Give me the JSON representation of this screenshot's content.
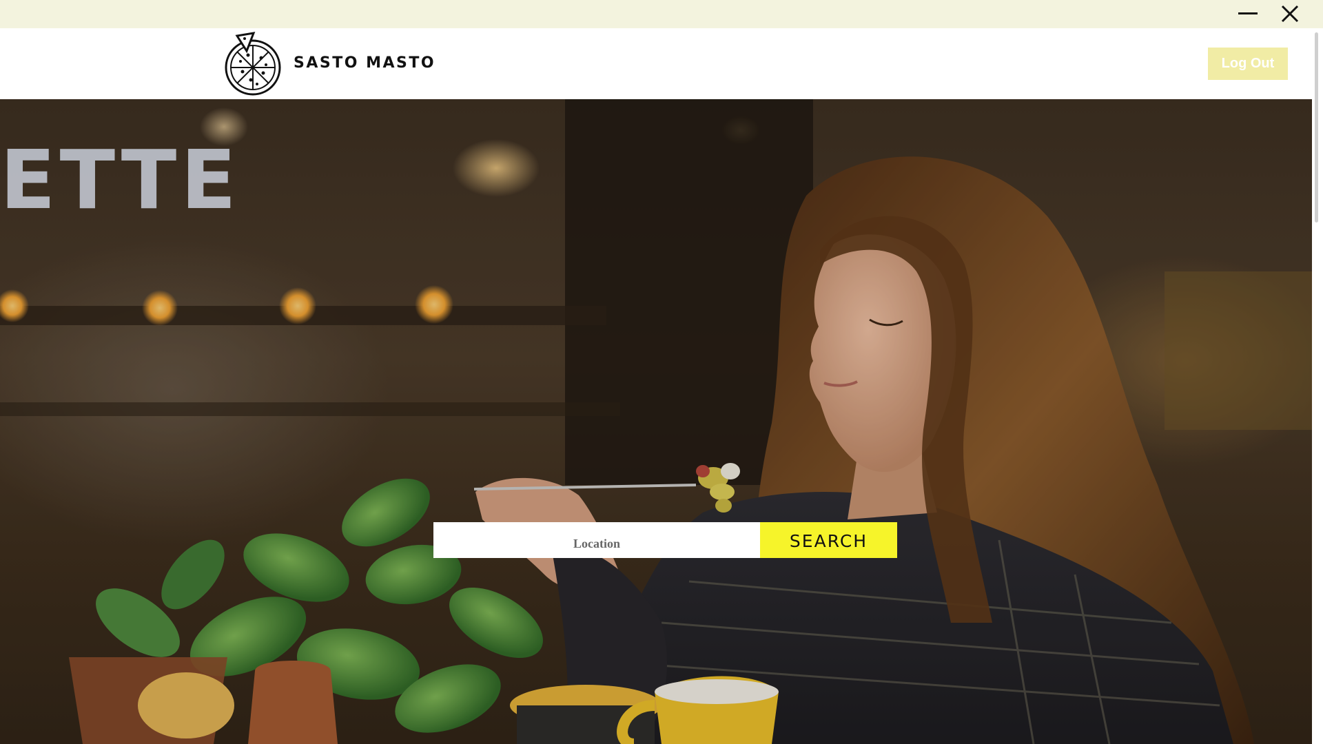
{
  "window": {
    "minimize_icon": "minimize-icon",
    "close_icon": "close-icon",
    "titlebar_color": "#f3f3de"
  },
  "header": {
    "logo_icon": "pizza-icon",
    "brand_name": "SASTO MASTO",
    "logout_label": "Log Out",
    "logout_color": "#f1eca5"
  },
  "hero": {
    "image": "woman-eating-pasta-photo",
    "neon_sign_text": "ETTE",
    "search": {
      "location_placeholder": "Location",
      "location_value": "",
      "search_label": "SEARCH",
      "search_color": "#f6f42a"
    }
  }
}
